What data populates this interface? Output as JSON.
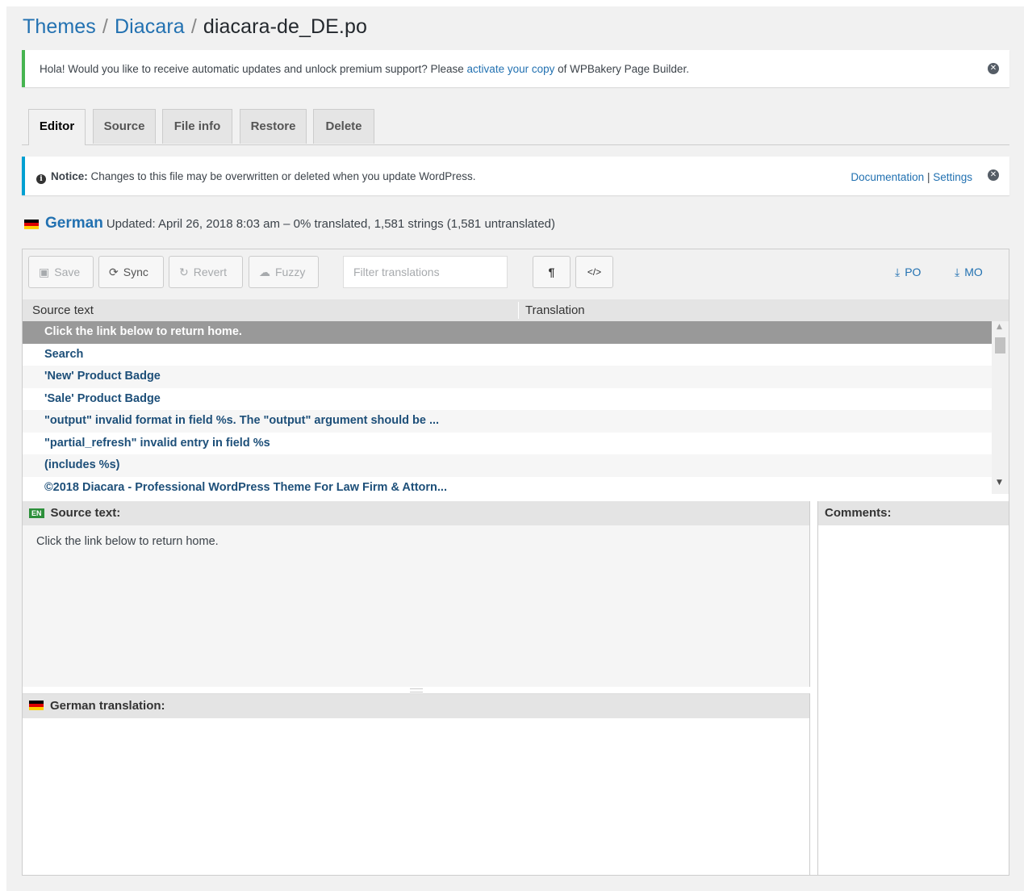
{
  "breadcrumb": {
    "part1": "Themes",
    "part2": "Diacara",
    "current": "diacara-de_DE.po",
    "sep": "/"
  },
  "update_notice": {
    "text_before": "Hola! Would you like to receive automatic updates and unlock premium support? Please ",
    "link": "activate your copy",
    "text_after": " of WPBakery Page Builder."
  },
  "tabs": [
    "Editor",
    "Source",
    "File info",
    "Restore",
    "Delete"
  ],
  "wp_notice": {
    "label": "Notice:",
    "text": " Changes to this file may be overwritten or deleted when you update WordPress.",
    "documentation": "Documentation",
    "separator": "|",
    "settings": "Settings"
  },
  "language": {
    "name": "German",
    "status": "Updated: April 26, 2018 8:03 am – 0% translated, 1,581 strings (1,581 untranslated)"
  },
  "toolbar": {
    "save": "Save",
    "sync": "Sync",
    "revert": "Revert",
    "fuzzy": "Fuzzy",
    "filter_placeholder": "Filter translations",
    "pilcrow": "¶",
    "code": "</>",
    "po": "PO",
    "mo": "MO"
  },
  "grid": {
    "headers": [
      "Source text",
      "Translation"
    ],
    "rows": [
      "Click the link below to return home.",
      "Search",
      "'New' Product Badge",
      "'Sale' Product Badge",
      "\"output\" invalid format in field %s. The \"output\" argument should be ...",
      "\"partial_refresh\" invalid entry in field %s",
      "(includes %s)",
      "©2018 Diacara - Professional WordPress Theme For Law Firm & Attorn..."
    ],
    "selected_index": 0
  },
  "source_pane": {
    "badge": "EN",
    "title": "Source text:",
    "text": "Click the link below to return home."
  },
  "translation_pane": {
    "title": "German translation:"
  },
  "comments_pane": {
    "title": "Comments:"
  },
  "colors": {
    "link": "#2271b1",
    "success": "#46b450",
    "info": "#00a0d2",
    "row_text": "#1d4f79"
  }
}
